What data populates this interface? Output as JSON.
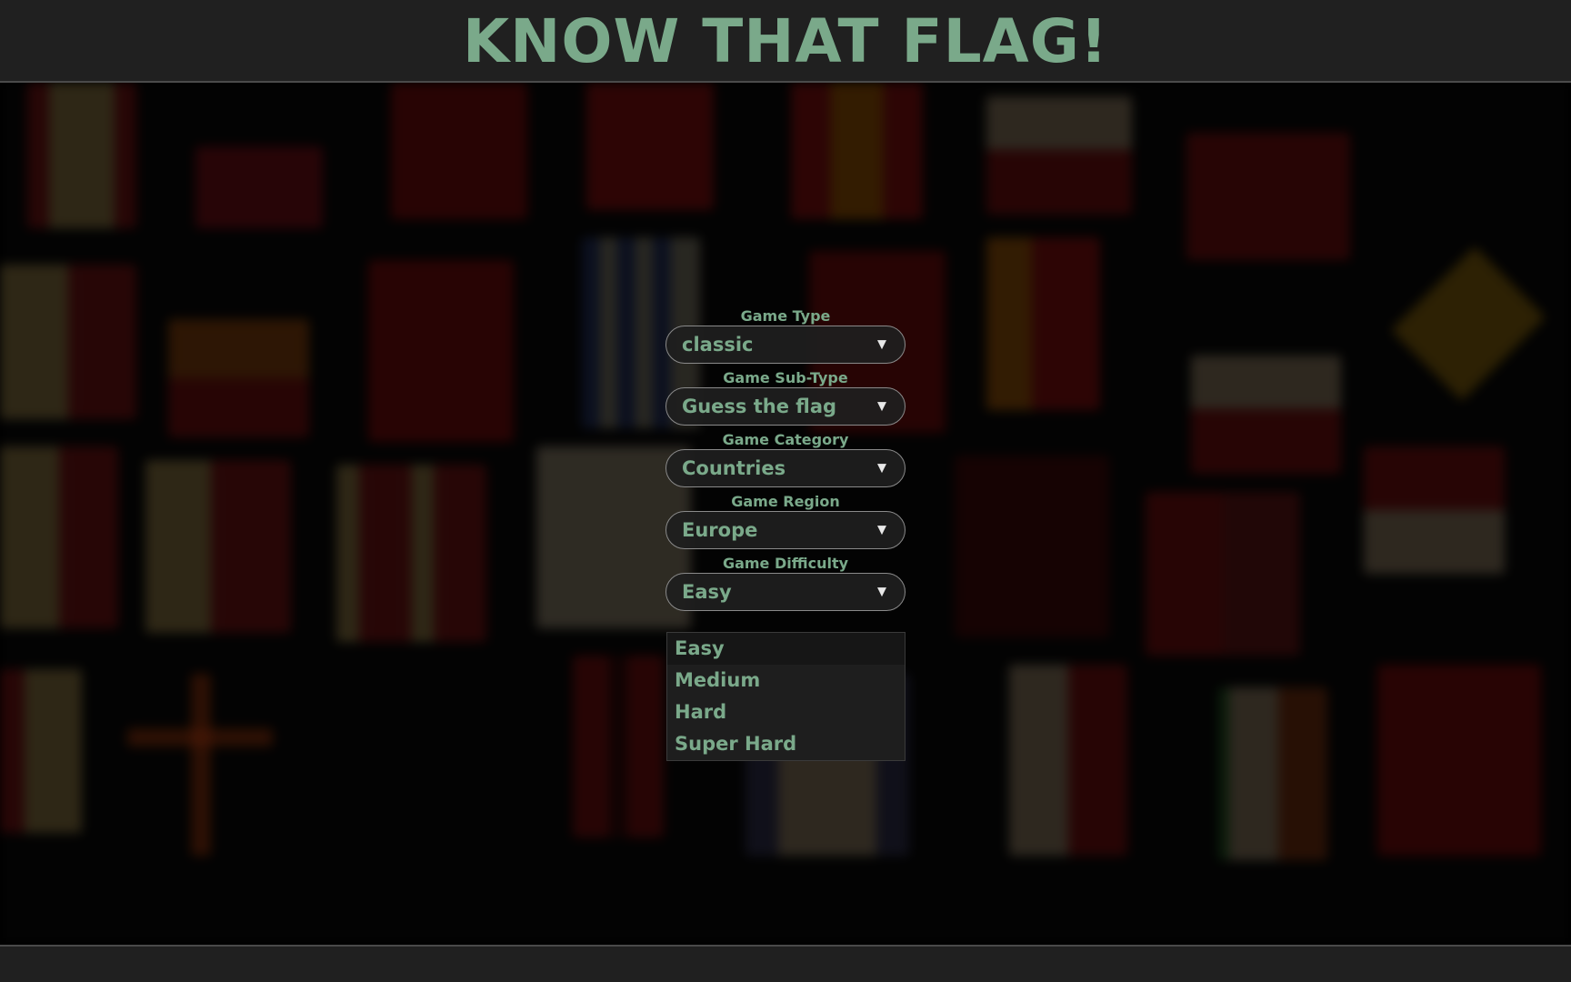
{
  "header": {
    "title": "KNOW THAT FLAG!"
  },
  "form": {
    "fields": [
      {
        "label": "Game Type",
        "value": "classic"
      },
      {
        "label": "Game Sub-Type",
        "value": "Guess the flag"
      },
      {
        "label": "Game Category",
        "value": "Countries"
      },
      {
        "label": "Game Region",
        "value": "Europe"
      },
      {
        "label": "Game Difficulty",
        "value": "Easy"
      }
    ],
    "arrow_icon": "▼"
  },
  "dropdown": {
    "options": [
      "Easy",
      "Medium",
      "Hard",
      "Super Hard"
    ],
    "selected": "Easy"
  },
  "colors": {
    "accent": "#7aa98a",
    "bar": "#202020"
  }
}
